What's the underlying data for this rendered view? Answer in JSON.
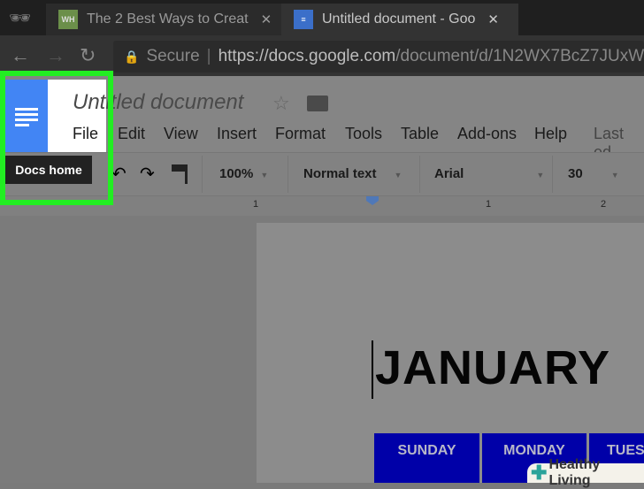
{
  "browser": {
    "tabs": [
      {
        "title": "The 2 Best Ways to Creat",
        "favicon": "WH"
      },
      {
        "title": "Untitled document - Goo"
      }
    ],
    "secure_label": "Secure",
    "url_host": "https://docs.google.com",
    "url_path": "/document/d/1N2WX7BcZ7JUxW"
  },
  "docs": {
    "title": "Untitled document",
    "menu": [
      "File",
      "Edit",
      "View",
      "Insert",
      "Format",
      "Tools",
      "Table",
      "Add-ons",
      "Help"
    ],
    "last_edit": "Last ed",
    "tooltip": "Docs home",
    "toolbar": {
      "zoom": "100%",
      "style": "Normal text",
      "font": "Arial",
      "size": "30"
    },
    "ruler": [
      "1",
      "1",
      "2"
    ]
  },
  "document": {
    "heading": "JANUARY",
    "days": [
      "SUNDAY",
      "MONDAY",
      "TUES"
    ]
  },
  "watermark": "Healthy Living",
  "colors": {
    "highlight": "#22ee22",
    "table_header": "#0000a8",
    "docs_blue": "#4285f4"
  }
}
